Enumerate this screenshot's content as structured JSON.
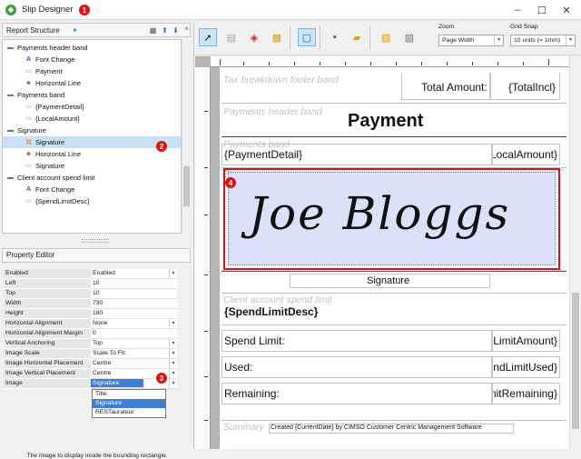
{
  "window": {
    "title": "Slip Designer",
    "app_icon": "green-circle-icon"
  },
  "report_structure": {
    "title": "Report Structure",
    "tree": [
      {
        "label": "Payments header band",
        "icon": "band-icon"
      },
      {
        "label": "Font Change",
        "icon": "font-icon"
      },
      {
        "label": "Payment",
        "icon": "text-icon"
      },
      {
        "label": "Horizontal Line",
        "icon": "line-icon"
      },
      {
        "label": "Payments band",
        "icon": "band-icon"
      },
      {
        "label": "{PaymentDetail}",
        "icon": "text-icon"
      },
      {
        "label": "{LocalAmount}",
        "icon": "text-icon"
      },
      {
        "label": "Signature",
        "icon": "band-icon"
      },
      {
        "label": "Signature",
        "icon": "image-icon",
        "selected": true
      },
      {
        "label": "Horizontal Line",
        "icon": "line-icon"
      },
      {
        "label": "Signature",
        "icon": "text-icon"
      },
      {
        "label": "Client account spend limit",
        "icon": "band-icon"
      },
      {
        "label": "Font Change",
        "icon": "font-icon"
      },
      {
        "label": "{SpendLimitDesc}",
        "icon": "text-icon"
      }
    ]
  },
  "property_editor": {
    "title": "Property Editor",
    "rows": [
      {
        "name": "Enabled",
        "value": "Enabled",
        "dropdown": true
      },
      {
        "name": "Left",
        "value": "10"
      },
      {
        "name": "Top",
        "value": "10"
      },
      {
        "name": "Width",
        "value": "730"
      },
      {
        "name": "Height",
        "value": "180"
      },
      {
        "name": "Horizontal Alignment",
        "value": "None",
        "dropdown": true
      },
      {
        "name": "Horizontal Alignment Margin",
        "value": "0"
      },
      {
        "name": "Vertical Anchoring",
        "value": "Top",
        "dropdown": true
      },
      {
        "name": "Image Scale",
        "value": "Scale To Fit",
        "dropdown": true
      },
      {
        "name": "Image Horizontal Placement",
        "value": "Centre",
        "dropdown": true
      },
      {
        "name": "Image Vertical Placement",
        "value": "Centre",
        "dropdown": true
      },
      {
        "name": "Image",
        "value": "Signature",
        "dropdown": true,
        "selected": true
      }
    ],
    "image_options": [
      "Title",
      "Signature",
      "RESTaurateur"
    ],
    "image_selected": "Signature",
    "hint": "The image to display inside the bounding rectangle."
  },
  "toolbar": {
    "zoom_label": "Zoom",
    "zoom_value": "Page Width",
    "grid_label": "Grid Snap",
    "grid_value": "10 units (= 1mm)"
  },
  "markers": [
    "1",
    "2",
    "3",
    "4"
  ],
  "page": {
    "tax_band": "Tax breakdown footer band",
    "total_amount_label": "Total Amount:",
    "total_incl": "{TotalIncl}",
    "payments_header_band": "Payments header band",
    "payment_title": "Payment",
    "payments_band": "Payments band",
    "payment_detail": "{PaymentDetail}",
    "local_amount": "{LocalAmount}",
    "signature_band": "Signature",
    "signature_image_text": "Joe Bloggs",
    "signature_label": "Signature",
    "spend_band": "Client account spend limit",
    "spend_limit_desc": "{SpendLimitDesc}",
    "spend_limit_label": "Spend Limit:",
    "spend_limit_value": "{SpendLimitAmount}",
    "used_label": "Used:",
    "used_value": "{SpendLimitUsed}",
    "remaining_label": "Remaining:",
    "remaining_value": "{SpendLimitRemaining}",
    "summary_band": "Summary",
    "footer_text": "Created {CurrentDate} by CIMSO Customer Centric Management Software"
  },
  "colors": {
    "accent": "#3c7fd6",
    "selection_outline": "#e01010",
    "signature_fill": "#dedffb"
  }
}
